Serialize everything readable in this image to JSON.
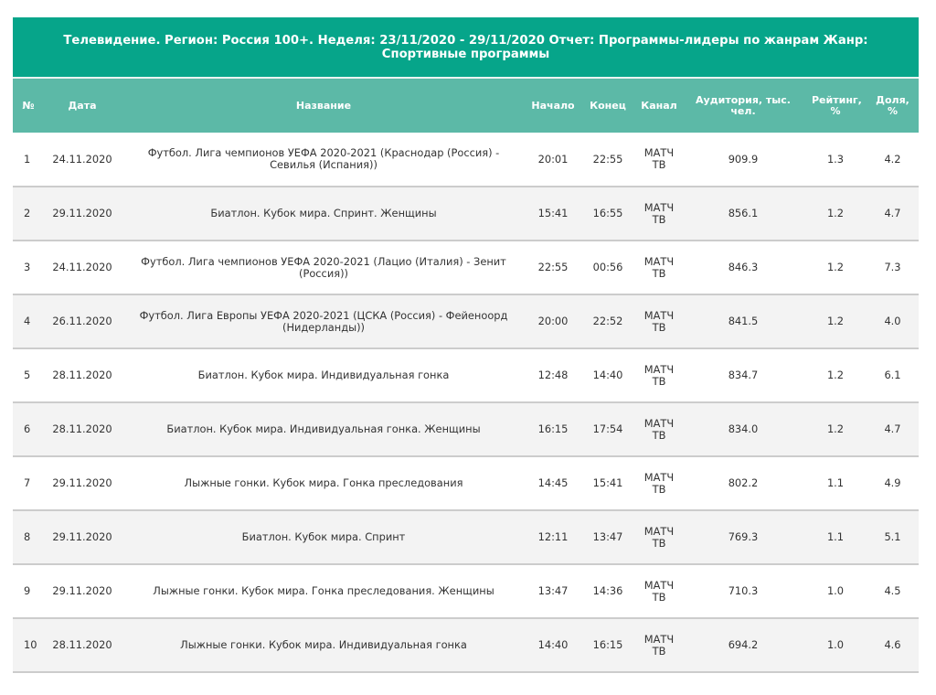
{
  "report": {
    "title": "Телевидение. Регион: Россия 100+. Неделя: 23/11/2020 - 29/11/2020 Отчет: Программы-лидеры по жанрам Жанр: Спортивные программы"
  },
  "table": {
    "headers": {
      "num": "№",
      "date": "Дата",
      "name": "Название",
      "start": "Начало",
      "end": "Конец",
      "channel": "Канал",
      "audience": "Аудитория, тыс. чел.",
      "rating": "Рейтинг, %",
      "share": "Доля, %"
    },
    "rows": [
      {
        "num": "1",
        "date": "24.11.2020",
        "name": "Футбол. Лига чемпионов УЕФА 2020-2021 (Краснодар (Россия) - Севилья (Испания))",
        "start": "20:01",
        "end": "22:55",
        "channel": "МАТЧ ТВ",
        "audience": "909.9",
        "rating": "1.3",
        "share": "4.2"
      },
      {
        "num": "2",
        "date": "29.11.2020",
        "name": "Биатлон. Кубок мира. Спринт. Женщины",
        "start": "15:41",
        "end": "16:55",
        "channel": "МАТЧ ТВ",
        "audience": "856.1",
        "rating": "1.2",
        "share": "4.7"
      },
      {
        "num": "3",
        "date": "24.11.2020",
        "name": "Футбол. Лига чемпионов УЕФА 2020-2021 (Лацио (Италия) - Зенит (Россия))",
        "start": "22:55",
        "end": "00:56",
        "channel": "МАТЧ ТВ",
        "audience": "846.3",
        "rating": "1.2",
        "share": "7.3"
      },
      {
        "num": "4",
        "date": "26.11.2020",
        "name": "Футбол. Лига Европы УЕФА 2020-2021 (ЦСКА (Россия) - Фейеноорд (Нидерланды))",
        "start": "20:00",
        "end": "22:52",
        "channel": "МАТЧ ТВ",
        "audience": "841.5",
        "rating": "1.2",
        "share": "4.0"
      },
      {
        "num": "5",
        "date": "28.11.2020",
        "name": "Биатлон. Кубок мира. Индивидуальная гонка",
        "start": "12:48",
        "end": "14:40",
        "channel": "МАТЧ ТВ",
        "audience": "834.7",
        "rating": "1.2",
        "share": "6.1"
      },
      {
        "num": "6",
        "date": "28.11.2020",
        "name": "Биатлон. Кубок мира. Индивидуальная гонка. Женщины",
        "start": "16:15",
        "end": "17:54",
        "channel": "МАТЧ ТВ",
        "audience": "834.0",
        "rating": "1.2",
        "share": "4.7"
      },
      {
        "num": "7",
        "date": "29.11.2020",
        "name": "Лыжные гонки. Кубок мира. Гонка преследования",
        "start": "14:45",
        "end": "15:41",
        "channel": "МАТЧ ТВ",
        "audience": "802.2",
        "rating": "1.1",
        "share": "4.9"
      },
      {
        "num": "8",
        "date": "29.11.2020",
        "name": "Биатлон. Кубок мира. Спринт",
        "start": "12:11",
        "end": "13:47",
        "channel": "МАТЧ ТВ",
        "audience": "769.3",
        "rating": "1.1",
        "share": "5.1"
      },
      {
        "num": "9",
        "date": "29.11.2020",
        "name": "Лыжные гонки. Кубок мира. Гонка преследования. Женщины",
        "start": "13:47",
        "end": "14:36",
        "channel": "МАТЧ ТВ",
        "audience": "710.3",
        "rating": "1.0",
        "share": "4.5"
      },
      {
        "num": "10",
        "date": "28.11.2020",
        "name": "Лыжные гонки. Кубок мира. Индивидуальная гонка",
        "start": "14:40",
        "end": "16:15",
        "channel": "МАТЧ ТВ",
        "audience": "694.2",
        "rating": "1.0",
        "share": "4.6"
      }
    ]
  },
  "colors": {
    "title_bg": "#06a58a",
    "header_bg": "#5cb9a7",
    "row_alt_bg": "#f3f3f3",
    "row_divider": "#cccccc"
  }
}
